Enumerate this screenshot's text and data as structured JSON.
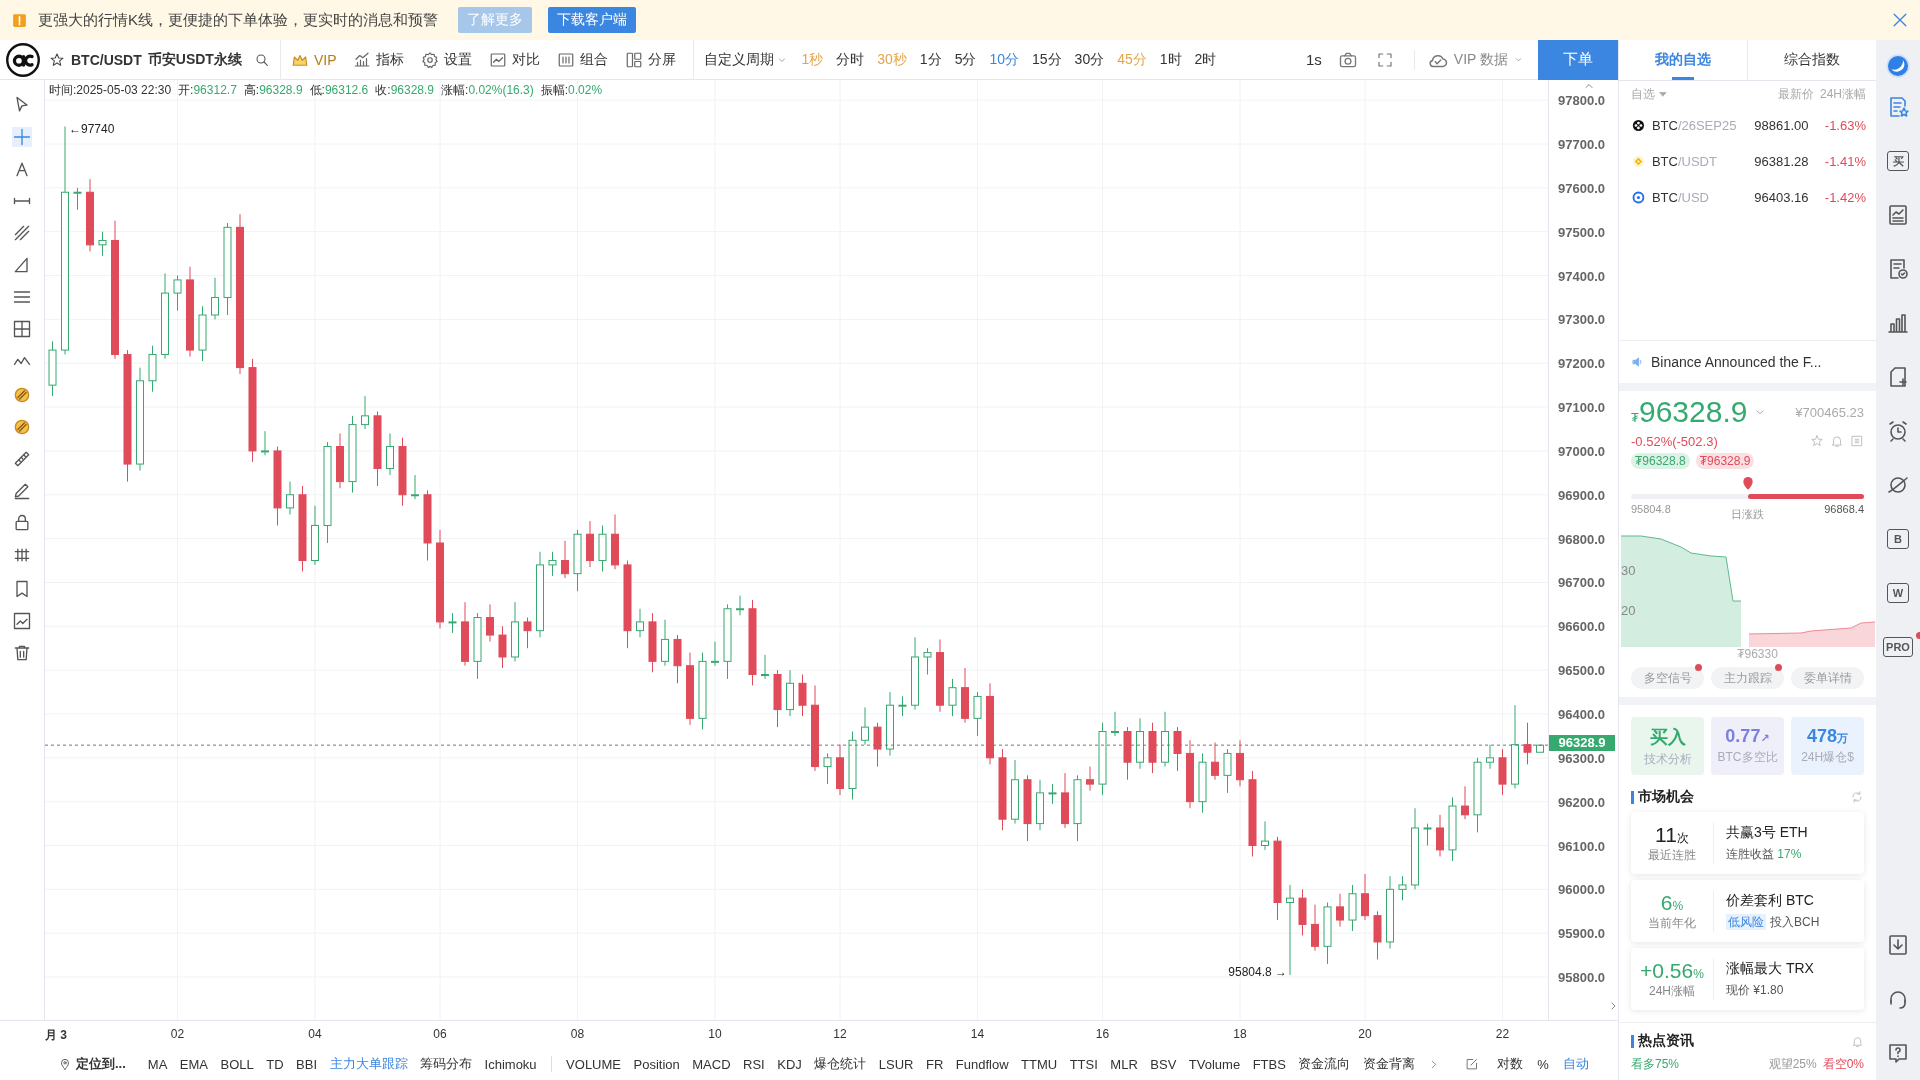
{
  "banner": {
    "message": "更强大的行情K线，更便捷的下单体验，更实时的消息和预警",
    "buttons": [
      {
        "label": "了解更多",
        "kind": "secondary"
      },
      {
        "label": "下载客户端",
        "kind": "primary"
      }
    ]
  },
  "toolbar": {
    "symbol": "BTC/USDT",
    "exchange": "币安USDT永续",
    "tools": [
      {
        "label": "VIP",
        "kind": "vip"
      },
      {
        "label": "指标",
        "kind": "indicators"
      },
      {
        "label": "设置",
        "kind": "settings"
      },
      {
        "label": "对比",
        "kind": "compare"
      },
      {
        "label": "组合",
        "kind": "combo"
      },
      {
        "label": "分屏",
        "kind": "split"
      }
    ],
    "period_menu": "自定义周期",
    "periods": [
      {
        "label": "1秒",
        "selected": false,
        "vip": true
      },
      {
        "label": "分时",
        "selected": false,
        "vip": false
      },
      {
        "label": "30秒",
        "selected": false,
        "vip": true
      },
      {
        "label": "1分",
        "selected": false,
        "vip": false
      },
      {
        "label": "5分",
        "selected": false,
        "vip": false
      },
      {
        "label": "10分",
        "selected": true,
        "vip": false
      },
      {
        "label": "15分",
        "selected": false,
        "vip": false
      },
      {
        "label": "30分",
        "selected": false,
        "vip": false
      },
      {
        "label": "45分",
        "selected": false,
        "vip": true
      },
      {
        "label": "1时",
        "selected": false,
        "vip": false
      },
      {
        "label": "2时",
        "selected": false,
        "vip": false
      }
    ],
    "interval": "1s",
    "vip_data": "VIP 数据",
    "order_button": "下单"
  },
  "drawing_tools": [
    {
      "tools": [
        {
          "kind": "cursor",
          "selected": false
        },
        {
          "kind": "crosshair",
          "selected": true
        },
        {
          "kind": "text",
          "selected": false
        },
        {
          "kind": "hline",
          "selected": false
        },
        {
          "kind": "fork",
          "selected": false
        },
        {
          "kind": "triangle",
          "selected": false
        },
        {
          "kind": "hlines",
          "selected": false
        },
        {
          "kind": "gridplus",
          "selected": false
        },
        {
          "kind": "wave",
          "selected": false
        }
      ]
    },
    {
      "tools": [
        {
          "kind": "pattern",
          "selected": false
        },
        {
          "kind": "pattern",
          "selected": false
        },
        {
          "kind": "ruler",
          "selected": false
        },
        {
          "kind": "pen",
          "selected": false
        },
        {
          "kind": "lock",
          "selected": false
        },
        {
          "kind": "magnet",
          "selected": false
        }
      ]
    },
    {
      "tools": [
        {
          "kind": "bookmark",
          "selected": false
        },
        {
          "kind": "editchart",
          "selected": false
        },
        {
          "kind": "trash",
          "selected": false
        }
      ]
    }
  ],
  "chart": {
    "info": [
      {
        "label": "时间:",
        "value": "2025-05-03 22:30",
        "kind": "time"
      },
      {
        "label": "开:",
        "value": "96312.7",
        "kind": "price"
      },
      {
        "label": "高:",
        "value": "96328.9",
        "kind": "price"
      },
      {
        "label": "低:",
        "value": "96312.6",
        "kind": "price"
      },
      {
        "label": "收:",
        "value": "96328.9",
        "kind": "price"
      },
      {
        "label": "涨幅:",
        "value": "0.02%(16.3)",
        "kind": "price"
      },
      {
        "label": "振幅:",
        "value": "0.02%",
        "kind": "price"
      }
    ],
    "high_label": "←97740",
    "low_label": "95804.8 →",
    "chart_data": {
      "type": "candlestick",
      "ylim": [
        95702,
        97846
      ],
      "grid": true,
      "ref_lines": [
        {
          "axis": "y",
          "value": 96328.9,
          "label": "96328.9"
        }
      ],
      "categories": [
        "月 3",
        null,
        null,
        null,
        null,
        null,
        null,
        null,
        null,
        null,
        "02",
        null,
        null,
        null,
        null,
        null,
        null,
        null,
        null,
        null,
        null,
        "04",
        null,
        null,
        null,
        null,
        null,
        null,
        null,
        null,
        null,
        "06",
        null,
        null,
        null,
        null,
        null,
        null,
        null,
        null,
        null,
        null,
        "08",
        null,
        null,
        null,
        null,
        null,
        null,
        null,
        null,
        null,
        null,
        "10",
        null,
        null,
        null,
        null,
        null,
        null,
        null,
        null,
        null,
        "12",
        null,
        null,
        null,
        null,
        null,
        null,
        null,
        null,
        null,
        null,
        "14",
        null,
        null,
        null,
        null,
        null,
        null,
        null,
        null,
        null,
        "16",
        null,
        null,
        null,
        null,
        null,
        null,
        null,
        null,
        null,
        null,
        "18",
        null,
        null,
        null,
        null,
        null,
        null,
        null,
        null,
        null,
        "20",
        null,
        null,
        null,
        null,
        null,
        null,
        null,
        null,
        null,
        null,
        "22",
        null,
        null,
        null
      ],
      "ohlc": [
        [
          97150,
          97250,
          97125,
          97230
        ],
        [
          97230,
          97740,
          97220,
          97590
        ],
        [
          97590,
          97600,
          97550,
          97590
        ],
        [
          97590,
          97620,
          97455,
          97470
        ],
        [
          97470,
          97500,
          97445,
          97480
        ],
        [
          97480,
          97525,
          97210,
          97220
        ],
        [
          97220,
          97230,
          96930,
          96970
        ],
        [
          96970,
          97190,
          96955,
          97160
        ],
        [
          97160,
          97240,
          97135,
          97220
        ],
        [
          97220,
          97405,
          97210,
          97360
        ],
        [
          97360,
          97400,
          97320,
          97390
        ],
        [
          97390,
          97420,
          97215,
          97230
        ],
        [
          97230,
          97330,
          97205,
          97310
        ],
        [
          97310,
          97395,
          97300,
          97350
        ],
        [
          97350,
          97520,
          97310,
          97510
        ],
        [
          97510,
          97540,
          97175,
          97190
        ],
        [
          97190,
          97210,
          96975,
          97000
        ],
        [
          97000,
          97045,
          96990,
          97000
        ],
        [
          97000,
          97010,
          96830,
          96870
        ],
        [
          96870,
          96930,
          96855,
          96900
        ],
        [
          96900,
          96920,
          96725,
          96750
        ],
        [
          96750,
          96875,
          96740,
          96830
        ],
        [
          96830,
          97020,
          96790,
          97010
        ],
        [
          97010,
          97040,
          96915,
          96930
        ],
        [
          96930,
          97080,
          96905,
          97060
        ],
        [
          97060,
          97125,
          97050,
          97080
        ],
        [
          97080,
          97090,
          96920,
          96960
        ],
        [
          96960,
          97040,
          96945,
          97010
        ],
        [
          97010,
          97030,
          96875,
          96900
        ],
        [
          96900,
          96945,
          96890,
          96900
        ],
        [
          96900,
          96910,
          96750,
          96790
        ],
        [
          96790,
          96820,
          96595,
          96610
        ],
        [
          96610,
          96630,
          96585,
          96610
        ],
        [
          96610,
          96655,
          96510,
          96520
        ],
        [
          96520,
          96630,
          96480,
          96620
        ],
        [
          96620,
          96650,
          96565,
          96580
        ],
        [
          96580,
          96600,
          96505,
          96530
        ],
        [
          96530,
          96655,
          96520,
          96610
        ],
        [
          96610,
          96620,
          96550,
          96590
        ],
        [
          96590,
          96770,
          96575,
          96740
        ],
        [
          96740,
          96770,
          96715,
          96750
        ],
        [
          96750,
          96795,
          96710,
          96720
        ],
        [
          96720,
          96820,
          96680,
          96810
        ],
        [
          96810,
          96840,
          96735,
          96750
        ],
        [
          96750,
          96830,
          96725,
          96810
        ],
        [
          96810,
          96855,
          96730,
          96740
        ],
        [
          96740,
          96750,
          96550,
          96590
        ],
        [
          96590,
          96640,
          96575,
          96610
        ],
        [
          96610,
          96630,
          96495,
          96520
        ],
        [
          96520,
          96615,
          96510,
          96570
        ],
        [
          96570,
          96580,
          96470,
          96510
        ],
        [
          96510,
          96540,
          96375,
          96390
        ],
        [
          96390,
          96540,
          96365,
          96520
        ],
        [
          96520,
          96565,
          96510,
          96520
        ],
        [
          96520,
          96650,
          96480,
          96640
        ],
        [
          96640,
          96670,
          96625,
          96640
        ],
        [
          96640,
          96660,
          96465,
          96490
        ],
        [
          96490,
          96535,
          96480,
          96490
        ],
        [
          96490,
          96500,
          96370,
          96410
        ],
        [
          96410,
          96500,
          96395,
          96470
        ],
        [
          96470,
          96490,
          96395,
          96420
        ],
        [
          96420,
          96465,
          96270,
          96280
        ],
        [
          96280,
          96310,
          96240,
          96300
        ],
        [
          96300,
          96330,
          96215,
          96230
        ],
        [
          96230,
          96360,
          96205,
          96340
        ],
        [
          96340,
          96415,
          96330,
          96370
        ],
        [
          96370,
          96380,
          96280,
          96320
        ],
        [
          96320,
          96450,
          96305,
          96420
        ],
        [
          96420,
          96440,
          96395,
          96420
        ],
        [
          96420,
          96575,
          96410,
          96530
        ],
        [
          96530,
          96550,
          96490,
          96540
        ],
        [
          96540,
          96570,
          96405,
          96420
        ],
        [
          96420,
          96480,
          96395,
          96460
        ],
        [
          96460,
          96505,
          96380,
          96390
        ],
        [
          96390,
          96450,
          96350,
          96440
        ],
        [
          96440,
          96470,
          96285,
          96300
        ],
        [
          96300,
          96320,
          96135,
          96160
        ],
        [
          96160,
          96295,
          96150,
          96250
        ],
        [
          96250,
          96260,
          96110,
          96150
        ],
        [
          96150,
          96250,
          96135,
          96220
        ],
        [
          96220,
          96240,
          96195,
          96220
        ],
        [
          96220,
          96265,
          96140,
          96150
        ],
        [
          96150,
          96260,
          96110,
          96250
        ],
        [
          96250,
          96280,
          96225,
          96240
        ],
        [
          96240,
          96380,
          96215,
          96360
        ],
        [
          96360,
          96405,
          96350,
          96360
        ],
        [
          96360,
          96370,
          96250,
          96290
        ],
        [
          96290,
          96390,
          96275,
          96360
        ],
        [
          96360,
          96380,
          96265,
          96290
        ],
        [
          96290,
          96405,
          96280,
          96360
        ],
        [
          96360,
          96370,
          96270,
          96310
        ],
        [
          96310,
          96340,
          96185,
          96200
        ],
        [
          96200,
          96310,
          96175,
          96290
        ],
        [
          96290,
          96335,
          96250,
          96260
        ],
        [
          96260,
          96320,
          96220,
          96310
        ],
        [
          96310,
          96340,
          96235,
          96250
        ],
        [
          96250,
          96270,
          96075,
          96100
        ],
        [
          96100,
          96155,
          96090,
          96110
        ],
        [
          96110,
          96120,
          95930,
          95970
        ],
        [
          95970,
          96010,
          95804.8,
          95980
        ],
        [
          95980,
          96000,
          95895,
          95920
        ],
        [
          95920,
          95965,
          95860,
          95870
        ],
        [
          95870,
          95970,
          95830,
          95960
        ],
        [
          95960,
          95990,
          95915,
          95930
        ],
        [
          95930,
          96010,
          95905,
          95990
        ],
        [
          95990,
          96035,
          95930,
          95940
        ],
        [
          95940,
          95950,
          95840,
          95880
        ],
        [
          95880,
          96030,
          95865,
          96000
        ],
        [
          96000,
          96030,
          95975,
          96010
        ],
        [
          96010,
          96185,
          96000,
          96140
        ],
        [
          96140,
          96150,
          96100,
          96140
        ],
        [
          96140,
          96170,
          96075,
          96090
        ],
        [
          96090,
          96210,
          96065,
          96190
        ],
        [
          96190,
          96235,
          96160,
          96170
        ],
        [
          96170,
          96300,
          96130,
          96290
        ],
        [
          96290,
          96330,
          96275,
          96300
        ],
        [
          96300,
          96320,
          96215,
          96240
        ],
        [
          96240,
          96420,
          96230,
          96330
        ],
        [
          96330,
          96380,
          96285,
          96312.7
        ],
        [
          96312.7,
          96328.9,
          96312.6,
          96328.9
        ]
      ],
      "yticks": [
        {
          "value": 97800,
          "label": "97800.0"
        },
        {
          "value": 97700,
          "label": "97700.0"
        },
        {
          "value": 97600,
          "label": "97600.0"
        },
        {
          "value": 97500,
          "label": "97500.0"
        },
        {
          "value": 97400,
          "label": "97400.0"
        },
        {
          "value": 97300,
          "label": "97300.0"
        },
        {
          "value": 97200,
          "label": "97200.0"
        },
        {
          "value": 97100,
          "label": "97100.0"
        },
        {
          "value": 97000,
          "label": "97000.0"
        },
        {
          "value": 96900,
          "label": "96900.0"
        },
        {
          "value": 96800,
          "label": "96800.0"
        },
        {
          "value": 96700,
          "label": "96700.0"
        },
        {
          "value": 96600,
          "label": "96600.0"
        },
        {
          "value": 96500,
          "label": "96500.0"
        },
        {
          "value": 96400,
          "label": "96400.0"
        },
        {
          "value": 96300,
          "label": "96300.0"
        },
        {
          "value": 96200,
          "label": "96200.0"
        },
        {
          "value": 96100,
          "label": "96100.0"
        },
        {
          "value": 96000,
          "label": "96000.0"
        },
        {
          "value": 95900,
          "label": "95900.0"
        },
        {
          "value": 95800,
          "label": "95800.0"
        }
      ]
    }
  },
  "indicator_bar": {
    "locate": "定位到...",
    "main": [
      {
        "label": "MA",
        "selected": false
      },
      {
        "label": "EMA",
        "selected": false
      },
      {
        "label": "BOLL",
        "selected": false
      },
      {
        "label": "TD",
        "selected": false
      },
      {
        "label": "BBI",
        "selected": false
      },
      {
        "label": "主力大单跟踪",
        "selected": true
      },
      {
        "label": "筹码分布",
        "selected": false
      },
      {
        "label": "Ichimoku",
        "selected": false
      }
    ],
    "sub": [
      {
        "label": "VOLUME",
        "selected": false
      },
      {
        "label": "Position",
        "selected": false
      },
      {
        "label": "MACD",
        "selected": false
      },
      {
        "label": "RSI",
        "selected": false
      },
      {
        "label": "KDJ",
        "selected": false
      },
      {
        "label": "爆仓统计",
        "selected": false
      },
      {
        "label": "LSUR",
        "selected": false
      },
      {
        "label": "FR",
        "selected": false
      },
      {
        "label": "Fundflow",
        "selected": false
      },
      {
        "label": "TTMU",
        "selected": false
      },
      {
        "label": "TTSI",
        "selected": false
      },
      {
        "label": "MLR",
        "selected": false
      },
      {
        "label": "BSV",
        "selected": false
      },
      {
        "label": "TVolume",
        "selected": false
      },
      {
        "label": "FTBS",
        "selected": false
      },
      {
        "label": "资金流向",
        "selected": false
      },
      {
        "label": "资金背离",
        "selected": false
      }
    ],
    "scale": [
      {
        "label": "对数",
        "selected": false
      },
      {
        "label": "%",
        "selected": false
      },
      {
        "label": "自动",
        "selected": true
      }
    ]
  },
  "panel": {
    "tabs": [
      {
        "label": "我的自选",
        "selected": true
      },
      {
        "label": "综合指数",
        "selected": false
      }
    ],
    "watchlist": {
      "filter": "自选",
      "columns": [
        "最新价",
        "24H涨幅"
      ],
      "rows": [
        {
          "base": "BTC",
          "quote": "/26SEP25",
          "price": "98861.00",
          "change": "-1.63%",
          "kind": "futures"
        },
        {
          "base": "BTC",
          "quote": "/USDT",
          "price": "96381.28",
          "change": "-1.41%",
          "kind": "binance"
        },
        {
          "base": "BTC",
          "quote": "/USD",
          "price": "96403.16",
          "change": "-1.42%",
          "kind": "ring"
        }
      ]
    },
    "news": "Binance Announced the F...",
    "quote": {
      "currency": "₮",
      "price": "96328.9",
      "cny": "¥700465.23",
      "change": "-0.52%(-502.3)",
      "bid": "₮96328.8",
      "ask": "₮96328.9",
      "range_low": "95804.8",
      "range_label": "日涨跌",
      "range_high": "96868.4",
      "level": 0.5
    },
    "depth": {
      "ticks": [
        "30",
        "20"
      ],
      "mid_price": "₮96330"
    },
    "signal_tabs": [
      {
        "label": "多空信号",
        "dot": true
      },
      {
        "label": "主力跟踪",
        "dot": true
      },
      {
        "label": "委单详情",
        "dot": false
      }
    ],
    "stats": [
      {
        "value": "买入",
        "caption": "技术分析",
        "kind": "buy"
      },
      {
        "value": "0.77",
        "unit": "↗",
        "caption": "BTC多空比",
        "kind": "ratio"
      },
      {
        "value": "478",
        "unit": "万",
        "caption": "24H爆仓$",
        "kind": "liquidation"
      }
    ],
    "opportunities": {
      "title": "市场机会",
      "items": [
        {
          "kind": "streak",
          "value": "11",
          "unit": "次",
          "caption": "最近连胜",
          "title": "共赢3号 ETH",
          "detail": "连胜收益",
          "highlight": "17%"
        },
        {
          "kind": "arbitrage",
          "value": "6",
          "unit": "%",
          "caption": "当前年化",
          "title": "价差套利 BTC",
          "tag": "低风险",
          "detail": "投入BCH"
        },
        {
          "kind": "gainer",
          "value": "+0.56",
          "unit": "%",
          "caption": "24H涨幅",
          "title": "涨幅最大 TRX",
          "detail": "现价 ¥1.80"
        }
      ]
    },
    "hot_news": {
      "title": "热点资讯",
      "sentiment": [
        {
          "label": "看多75%",
          "kind": "bull"
        },
        {
          "label": "观望25%",
          "kind": "neutral"
        },
        {
          "label": "看空0%",
          "kind": "bear"
        }
      ]
    }
  },
  "icon_bar": {
    "top": [
      {
        "kind": "watchlist",
        "selected": true
      },
      {
        "kind": "glyph",
        "glyph": "买",
        "selected": false
      },
      {
        "kind": "trenddoc",
        "selected": false
      },
      {
        "kind": "doccheck",
        "selected": false
      },
      {
        "kind": "bars",
        "selected": false
      },
      {
        "kind": "newdoc",
        "selected": false
      },
      {
        "kind": "alarm",
        "selected": false
      },
      {
        "kind": "planet",
        "selected": false
      },
      {
        "kind": "glyph",
        "glyph": "B",
        "selected": false
      },
      {
        "kind": "glyph",
        "glyph": "W",
        "selected": false
      },
      {
        "kind": "glyph",
        "glyph": "PRO",
        "selected": false,
        "dot": true
      }
    ],
    "bottom": [
      {
        "kind": "download",
        "selected": false
      },
      {
        "kind": "headset",
        "selected": false
      },
      {
        "kind": "help",
        "selected": false
      }
    ]
  }
}
